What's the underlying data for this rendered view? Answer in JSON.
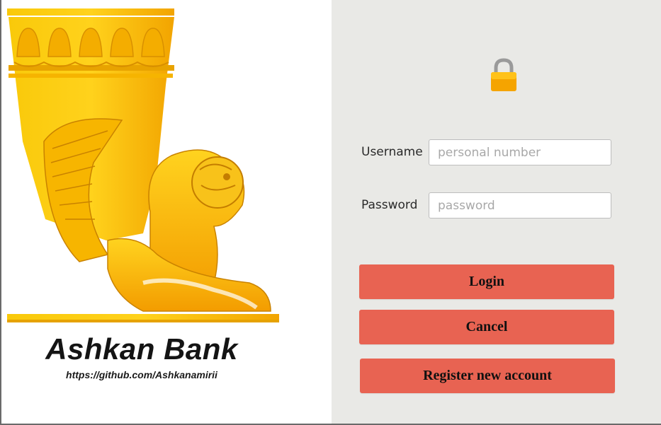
{
  "branding": {
    "name": "Ashkan Bank",
    "url": "https://github.com/Ashkanamirii"
  },
  "login_form": {
    "lock_icon": "lock-icon",
    "username": {
      "label": "Username",
      "placeholder": "personal number",
      "value": ""
    },
    "password": {
      "label": "Password",
      "placeholder": "password",
      "value": ""
    }
  },
  "buttons": {
    "login": "Login",
    "cancel": "Cancel",
    "register": "Register new account"
  },
  "colors": {
    "button": "#e86352",
    "right_panel_bg": "#e9e9e6",
    "logo_gold": "#f5b800",
    "lock_body": "#f5a400"
  }
}
